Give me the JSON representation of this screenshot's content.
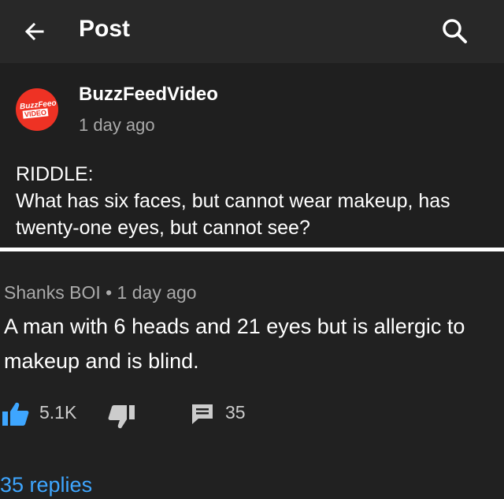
{
  "header": {
    "title": "Post"
  },
  "post": {
    "avatar_text_top": "BuzzFeeo",
    "avatar_text_bottom": "VIDEO",
    "channel": "BuzzFeedVideo",
    "time": "1 day ago",
    "body": "RIDDLE:\nWhat has six faces, but cannot wear makeup, has\ntwenty-one eyes, but cannot see?"
  },
  "comment": {
    "meta": "Shanks BOI • 1 day ago",
    "text": "A man with 6 heads and 21 eyes but is allergic to makeup and is blind.",
    "likes": "5.1K",
    "reply_count": "35",
    "replies_link": "35 replies"
  },
  "colors": {
    "link": "#3ea6ff",
    "accent_like": "#3ea6ff",
    "avatar_bg": "#ee3224"
  },
  "icons": [
    "back-arrow-icon",
    "search-icon",
    "like-icon",
    "dislike-icon",
    "reply-icon"
  ]
}
